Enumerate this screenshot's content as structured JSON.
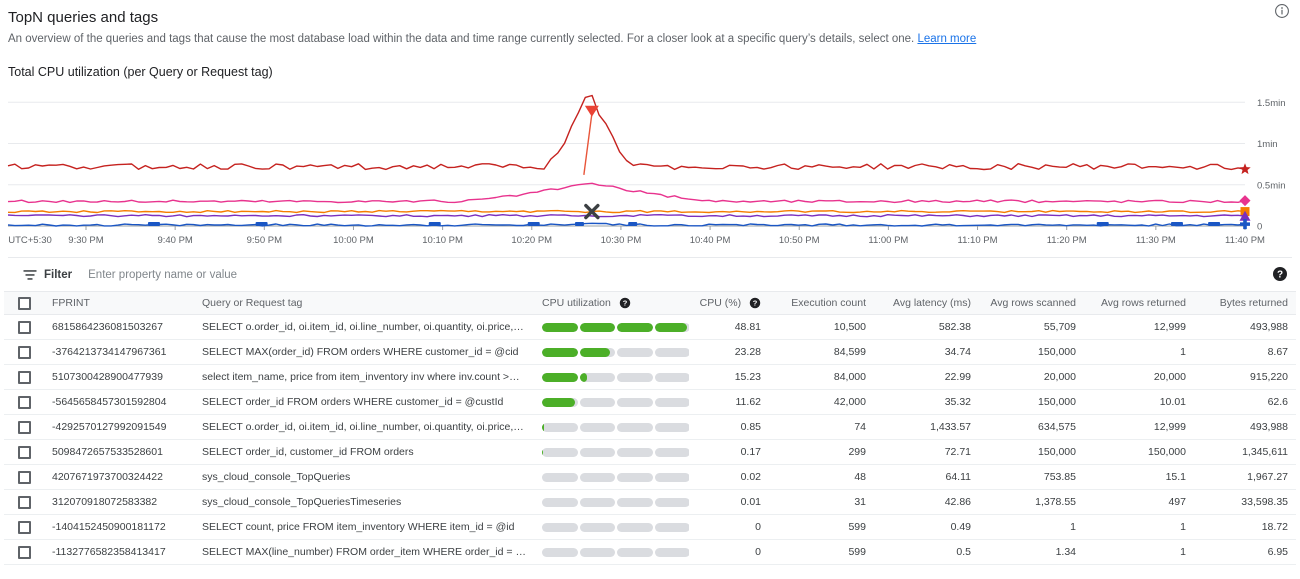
{
  "header": {
    "title": "TopN queries and tags",
    "description_part1": "An overview of the queries and tags that cause the most database load within the data and time range currently selected. For a closer look at a specific query’s details, select one. ",
    "learn_more": "Learn more",
    "info_icon": "info-icon"
  },
  "chart_title": "Total CPU utilization (per Query or Request tag)",
  "filter": {
    "icon": "filter-icon",
    "label": "Filter",
    "placeholder": "Enter property name or value",
    "help_icon": "help-icon"
  },
  "table": {
    "columns": [
      {
        "key": "checkbox",
        "label": ""
      },
      {
        "key": "fprint",
        "label": "FPRINT"
      },
      {
        "key": "query",
        "label": "Query or Request tag"
      },
      {
        "key": "cpubar",
        "label": "CPU utilization",
        "help": true
      },
      {
        "key": "cpu",
        "label": "CPU (%)",
        "help": true
      },
      {
        "key": "exec",
        "label": "Execution count"
      },
      {
        "key": "lat",
        "label": "Avg latency (ms)"
      },
      {
        "key": "scan",
        "label": "Avg rows scanned"
      },
      {
        "key": "ret",
        "label": "Avg rows returned"
      },
      {
        "key": "bytes",
        "label": "Bytes returned"
      }
    ],
    "rows": [
      {
        "fprint": "6815864236081503267",
        "query": "SELECT o.order_id, oi.item_id, oi.line_number, oi.quantity, oi.price, …",
        "cpu_pct": 48.81,
        "cpu": "48.81",
        "exec": "10,500",
        "lat": "582.38",
        "scan": "55,709",
        "ret": "12,999",
        "bytes": "493,988"
      },
      {
        "fprint": "-3764213734147967361",
        "query": "SELECT MAX(order_id) FROM orders WHERE customer_id = @cid",
        "cpu_pct": 23.28,
        "cpu": "23.28",
        "exec": "84,599",
        "lat": "34.74",
        "scan": "150,000",
        "ret": "1",
        "bytes": "8.67"
      },
      {
        "fprint": "5107300428900477939",
        "query": "select item_name, price from item_inventory inv where inv.count >…",
        "cpu_pct": 15.23,
        "cpu": "15.23",
        "exec": "84,000",
        "lat": "22.99",
        "scan": "20,000",
        "ret": "20,000",
        "bytes": "915,220"
      },
      {
        "fprint": "-5645658457301592804",
        "query": "SELECT order_id FROM orders WHERE customer_id = @custId",
        "cpu_pct": 11.62,
        "cpu": "11.62",
        "exec": "42,000",
        "lat": "35.32",
        "scan": "150,000",
        "ret": "10.01",
        "bytes": "62.6"
      },
      {
        "fprint": "-4292570127992091549",
        "query": "SELECT o.order_id, oi.item_id, oi.line_number, oi.quantity, oi.price, …",
        "cpu_pct": 0.85,
        "cpu": "0.85",
        "exec": "74",
        "lat": "1,433.57",
        "scan": "634,575",
        "ret": "12,999",
        "bytes": "493,988"
      },
      {
        "fprint": "5098472657533528601",
        "query": "SELECT order_id, customer_id FROM orders",
        "cpu_pct": 0.17,
        "cpu": "0.17",
        "exec": "299",
        "lat": "72.71",
        "scan": "150,000",
        "ret": "150,000",
        "bytes": "1,345,611"
      },
      {
        "fprint": "4207671973700324422",
        "query": "sys_cloud_console_TopQueries",
        "cpu_pct": 0.02,
        "cpu": "0.02",
        "exec": "48",
        "lat": "64.11",
        "scan": "753.85",
        "ret": "15.1",
        "bytes": "1,967.27"
      },
      {
        "fprint": "312070918072583382",
        "query": "sys_cloud_console_TopQueriesTimeseries",
        "cpu_pct": 0.01,
        "cpu": "0.01",
        "exec": "31",
        "lat": "42.86",
        "scan": "1,378.55",
        "ret": "497",
        "bytes": "33,598.35"
      },
      {
        "fprint": "-1404152450900181172",
        "query": "SELECT count, price FROM item_inventory WHERE item_id = @id",
        "cpu_pct": 0,
        "cpu": "0",
        "exec": "599",
        "lat": "0.49",
        "scan": "1",
        "ret": "1",
        "bytes": "18.72"
      },
      {
        "fprint": "-1132776582358413417",
        "query": "SELECT MAX(line_number) FROM order_item WHERE order_id = …",
        "cpu_pct": 0,
        "cpu": "0",
        "exec": "599",
        "lat": "0.5",
        "scan": "1.34",
        "ret": "1",
        "bytes": "6.95"
      }
    ]
  },
  "chart_data": {
    "type": "line",
    "title": "Total CPU utilization (per Query or Request tag)",
    "xlabel": "",
    "ylabel": "",
    "timezone_label": "UTC+5:30",
    "y_ticks": [
      "1.5min",
      "1min",
      "0.5min",
      "0"
    ],
    "y_tick_values": [
      1.5,
      1.0,
      0.5,
      0
    ],
    "ylim": [
      0,
      1.6
    ],
    "grid": true,
    "legend": "none",
    "x_ticks": [
      "9:30 PM",
      "9:40 PM",
      "9:50 PM",
      "10:00 PM",
      "10:10 PM",
      "10:20 PM",
      "10:30 PM",
      "10:40 PM",
      "10:50 PM",
      "11:00 PM",
      "11:10 PM",
      "11:20 PM",
      "11:30 PM",
      "11:40 PM"
    ],
    "series": [
      {
        "name": "series-red-star",
        "color": "#c5221f",
        "marker": "star",
        "baseline": 0.72,
        "noise": 0.035,
        "spike_at": 0.47,
        "spike_height": 0.92,
        "spike_width": 0.012
      },
      {
        "name": "series-pink-diamond",
        "color": "#e8338e",
        "marker": "diamond",
        "baseline": 0.3,
        "noise": 0.015,
        "spike_at": 0.47,
        "spike_height": 0.22,
        "spike_width": 0.035
      },
      {
        "name": "series-orange-square",
        "color": "#f57c00",
        "marker": "square",
        "baseline": 0.175,
        "noise": 0.012,
        "spike_at": 0.47,
        "spike_height": 0.0,
        "spike_width": 0.02
      },
      {
        "name": "series-purple-triangle",
        "color": "#7b2fbe",
        "marker": "triangle",
        "baseline": 0.125,
        "noise": 0.012,
        "spike_at": 0.47,
        "spike_height": 0.0,
        "spike_width": 0.02
      },
      {
        "name": "series-blue-plus",
        "color": "#1a56c4",
        "marker": "plus",
        "baseline": 0.012,
        "noise": 0.012,
        "spike_at": 0.47,
        "spike_height": 0.03,
        "spike_width": 0.01
      }
    ],
    "annotations": [
      {
        "name": "red-spike-marker",
        "shape": "down-triangle",
        "color": "#ea4335",
        "x_frac": 0.472,
        "y_value": 1.36
      },
      {
        "name": "dark-x-marker",
        "shape": "x",
        "color": "#3c4043",
        "x_frac": 0.472,
        "y_value": 0.175
      }
    ]
  }
}
